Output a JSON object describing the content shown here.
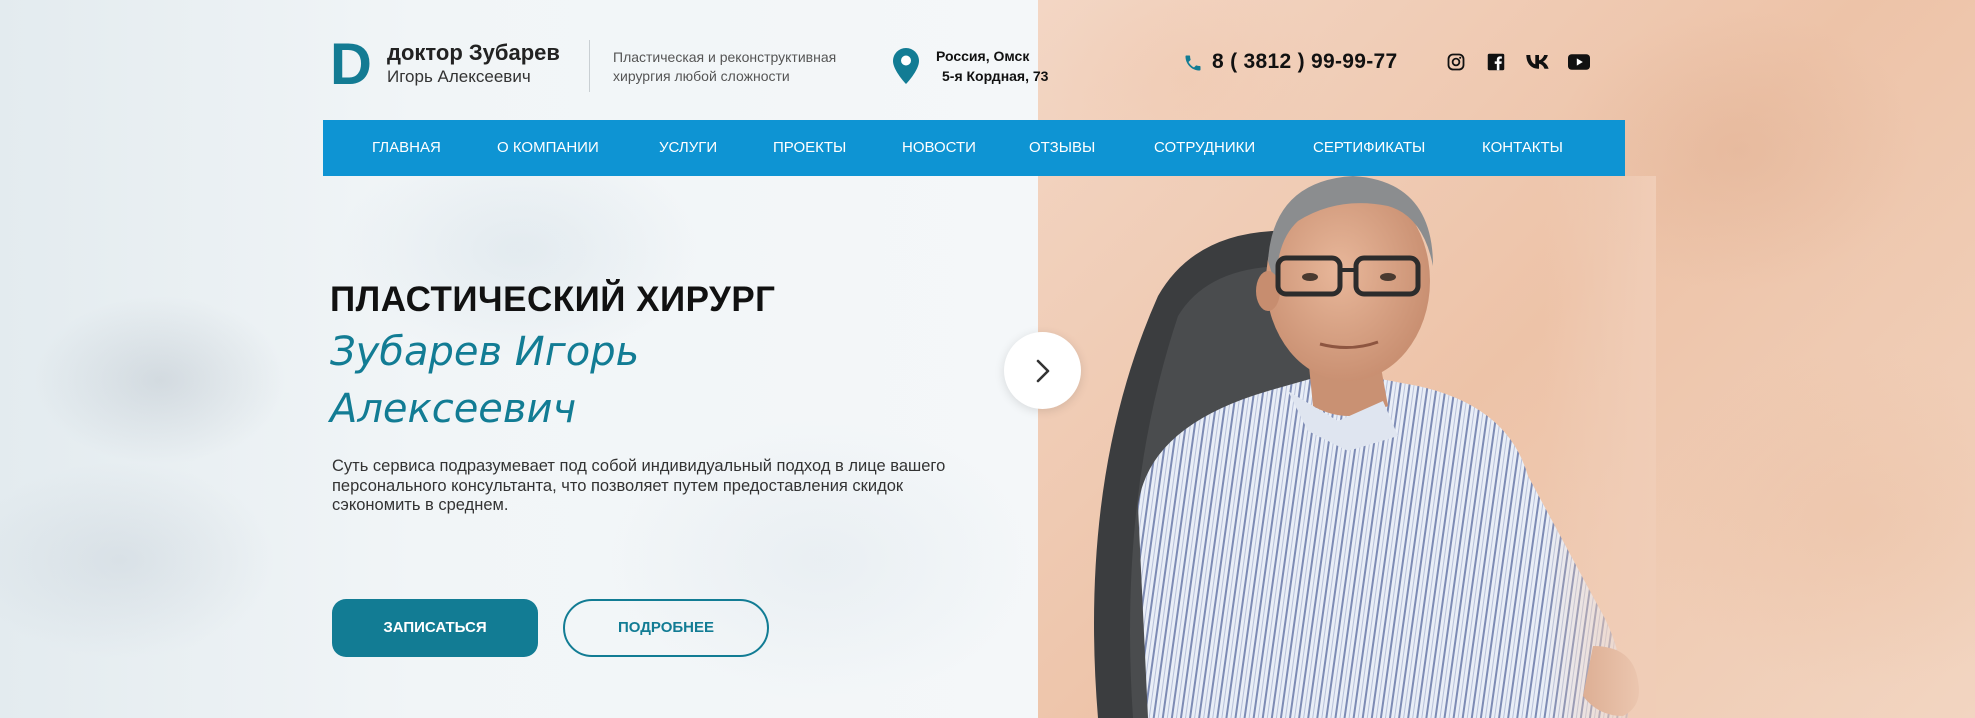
{
  "header": {
    "logo_letter": "D",
    "logo_name": "доктор Зубарев",
    "logo_subname": "Игорь Алексеевич",
    "tagline": "Пластическая и реконструктивная хирургия любой сложности",
    "address_line1": "Россия, Омск",
    "address_line2": "5-я Кордная, 73",
    "phone": "8 ( 3812 ) 99-99-77",
    "social_icons": [
      "instagram-icon",
      "facebook-icon",
      "vk-icon",
      "youtube-icon"
    ]
  },
  "nav": {
    "items": [
      {
        "label": "ГЛАВНАЯ"
      },
      {
        "label": "О КОМПАНИИ"
      },
      {
        "label": "УСЛУГИ"
      },
      {
        "label": "ПРОЕКТЫ"
      },
      {
        "label": "НОВОСТИ"
      },
      {
        "label": "ОТЗЫВЫ"
      },
      {
        "label": "СОТРУДНИКИ"
      },
      {
        "label": "СЕРТИФИКАТЫ"
      },
      {
        "label": "КОНТАКТЫ"
      }
    ]
  },
  "hero": {
    "kicker": "ПЛАСТИЧЕСКИЙ ХИРУРГ",
    "name_line1": "Зубарев Игорь",
    "name_line2": "Алексеевич",
    "description": "Суть сервиса подразумевает под собой индивидуальный подход в лице вашего персонального консультанта, что позволяет путем предоставления скидок сэкономить в среднем.",
    "primary_button": "ЗАПИСАТЬСЯ",
    "secondary_button": "ПОДРОБНЕЕ"
  },
  "colors": {
    "accent": "#127c94",
    "nav_bg": "#0e94d3"
  }
}
